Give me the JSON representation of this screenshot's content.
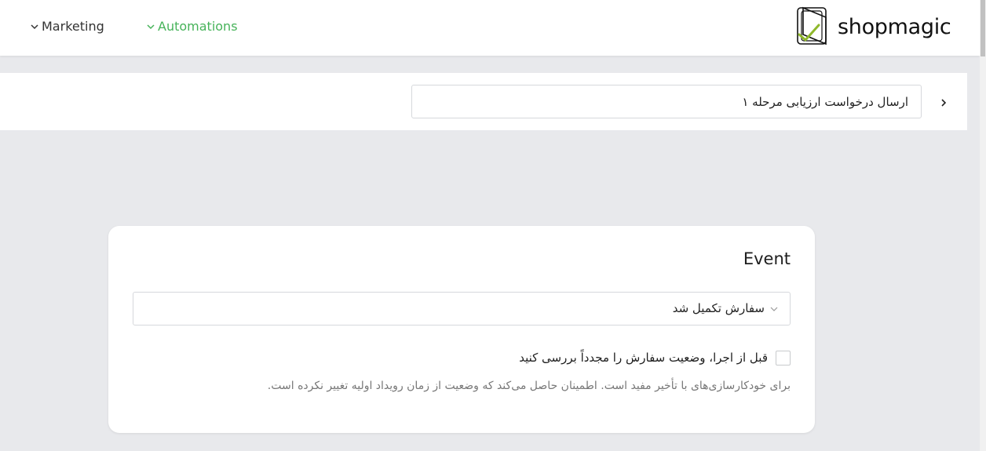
{
  "header": {
    "nav": [
      {
        "label": "Marketing"
      },
      {
        "label": "Automations"
      }
    ],
    "logo_text": "shopmagic",
    "accent_color": "#47b35a"
  },
  "automation": {
    "name": "ارسال درخواست ارزیابی مرحله ۱"
  },
  "event_card": {
    "title": "Event",
    "selected_event": "سفارش تکمیل شد",
    "checkbox_label": "قبل از اجرا، وضعیت سفارش را مجدداً بررسی کنید",
    "checkbox_checked": false,
    "help_text": "برای خودکارسازی‌های با تأخیر مفید است. اطمینان حاصل می‌کند که وضعیت از زمان رویداد اولیه تغییر نکرده است."
  }
}
